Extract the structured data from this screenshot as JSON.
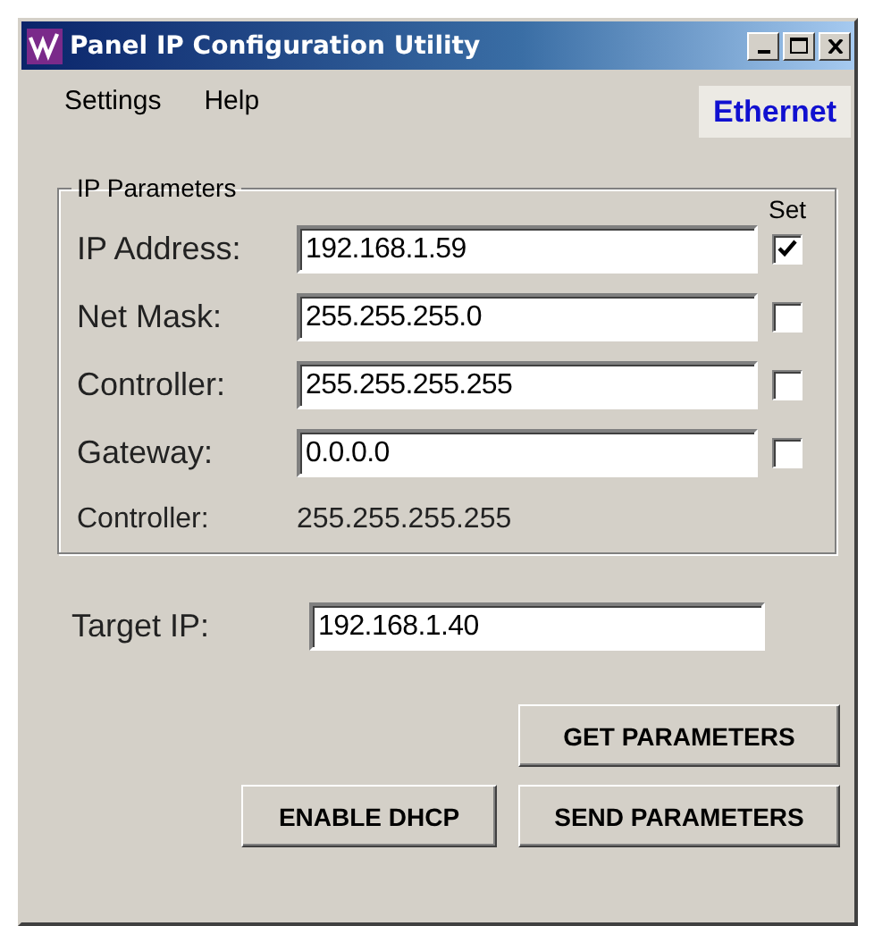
{
  "window": {
    "title": "Panel IP Configuration Utility"
  },
  "menu": [
    "Settings",
    "Help"
  ],
  "tabs": [
    {
      "label": "Ethernet",
      "selected": true
    }
  ],
  "ip_parameters": {
    "title": "IP Parameters",
    "set_header": "Set",
    "fields": [
      {
        "label": "IP Address:",
        "value": "192.168.1.59",
        "set": true
      },
      {
        "label": "Net Mask:",
        "value": "255.255.255.0",
        "set": false
      },
      {
        "label": "Controller:",
        "value": "255.255.255.255",
        "set": false
      },
      {
        "label": "Gateway:",
        "value": "0.0.0.0",
        "set": false
      }
    ],
    "readout": {
      "label": "Controller:",
      "value": "255.255.255.255"
    }
  },
  "target_ip": {
    "label": "Target IP:",
    "value": "192.168.1.40"
  },
  "buttons": [
    "GET PARAMETERS",
    "ENABLE DHCP",
    "SEND PARAMETERS"
  ]
}
